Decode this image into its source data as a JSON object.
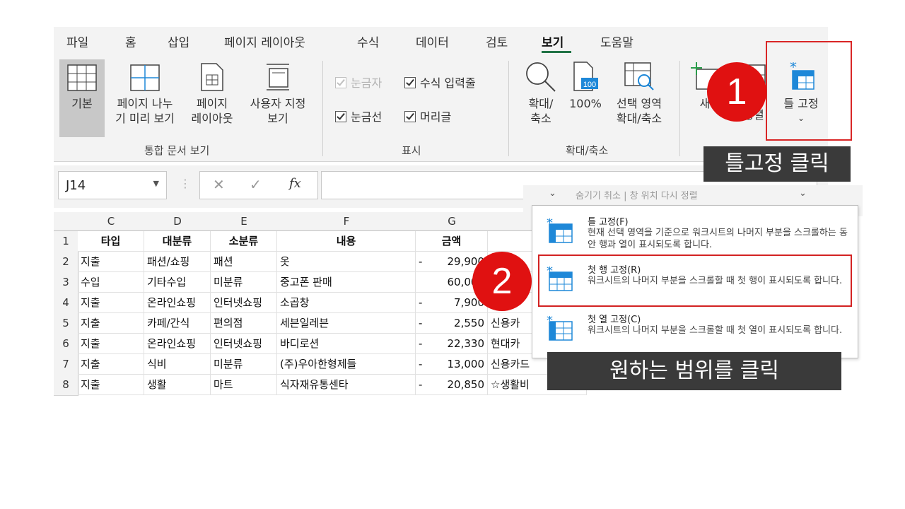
{
  "menubar": {
    "tabs": [
      "파일",
      "홈",
      "삽입",
      "페이지 레이아웃",
      "수식",
      "데이터",
      "검토",
      "보기",
      "도움말"
    ],
    "active": "보기"
  },
  "ribbon": {
    "views": {
      "normal": "기본",
      "pagebreak": [
        "페이지 나누",
        "기 미리 보기"
      ],
      "pagelayout": [
        "페이지",
        "레이아웃"
      ],
      "custom": [
        "사용자 지정",
        "보기"
      ],
      "group_label": "통합 문서 보기"
    },
    "show": {
      "ruler": "눈금자",
      "formula_bar": "수식 입력줄",
      "gridlines": "눈금선",
      "headings": "머리글",
      "group_label": "표시"
    },
    "zoom": {
      "zoom": [
        "확대/",
        "축소"
      ],
      "hundred": "100%",
      "selection": [
        "선택 영역",
        "확대/축소"
      ],
      "group_label": "확대/축소",
      "hundred_icon_text": "100"
    },
    "window": {
      "new_window": "새",
      "arrange_partial": "정렬",
      "freeze": "틀 고정",
      "freeze_caret": "⌄"
    }
  },
  "formula_bar": {
    "name_box": "J14",
    "fx": "fx"
  },
  "sheet": {
    "columns": [
      "C",
      "D",
      "E",
      "F",
      "G"
    ],
    "rows": [
      {
        "num": "1",
        "c": "타입",
        "d": "대분류",
        "e": "소분류",
        "f": "내용",
        "g": "금액",
        "h": ""
      },
      {
        "num": "2",
        "c": "지출",
        "d": "패션/쇼핑",
        "e": "패션",
        "f": "옷",
        "g": "29,900",
        "h": ""
      },
      {
        "num": "3",
        "c": "수입",
        "d": "기타수입",
        "e": "미분류",
        "f": "중고폰 판매",
        "g": "60,000",
        "h": ""
      },
      {
        "num": "4",
        "c": "지출",
        "d": "온라인쇼핑",
        "e": "인터넷쇼핑",
        "f": "소곱창",
        "g": "7,900",
        "h": ""
      },
      {
        "num": "5",
        "c": "지출",
        "d": "카페/간식",
        "e": "편의점",
        "f": "세븐일레븐",
        "g": "2,550",
        "h": "신용카"
      },
      {
        "num": "6",
        "c": "지출",
        "d": "온라인쇼핑",
        "e": "인터넷쇼핑",
        "f": "바디로션",
        "g": "22,330",
        "h": "현대카"
      },
      {
        "num": "7",
        "c": "지출",
        "d": "식비",
        "e": "미분류",
        "f": "(주)우아한형제들",
        "g": "13,000",
        "h": "신용카드"
      },
      {
        "num": "8",
        "c": "지출",
        "d": "생활",
        "e": "마트",
        "f": "식자재유통센타",
        "g": "20,850",
        "h": "☆생활비"
      }
    ],
    "dash": "-"
  },
  "popup": {
    "behind_text": "숨기기 취소   |  창 위치 다시 정렬"
  },
  "freeze_menu": [
    {
      "title": "틀 고정(F)",
      "desc": "현재 선택 영역을 기준으로 워크시트의 나머지 부분을 스크롤하는 동안 행과 열이 표시되도록 합니다."
    },
    {
      "title": "첫 행 고정(R)",
      "desc": "워크시트의 나머지 부분을 스크롤할 때 첫 행이 표시되도록 합니다."
    },
    {
      "title": "첫 열 고정(C)",
      "desc": "워크시트의 나머지 부분을 스크롤할 때 첫 열이 표시되도록 합니다."
    }
  ],
  "annotations": {
    "step1_number": "1",
    "step1_label": "틀고정 클릭",
    "step2_number": "2",
    "step2_label": "원하는 범위를 클릭"
  },
  "colors": {
    "excel_green": "#217346",
    "accent_red": "#e01111",
    "callout_bg": "#3a3a3a",
    "icon_blue": "#1e88d8"
  }
}
